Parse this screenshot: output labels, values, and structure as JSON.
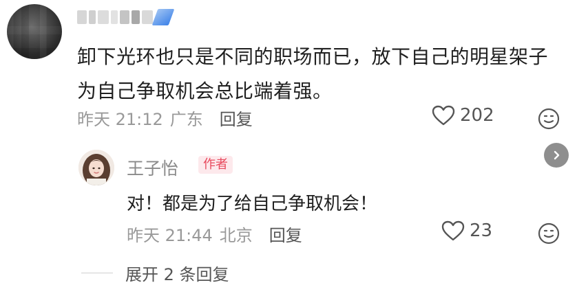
{
  "comment": {
    "text": "卸下光环也只是不同的职场而已，放下自己的明星架子为自己争取机会总比端着强。",
    "time": "昨天 21:12",
    "location": "广东",
    "reply_label": "回复",
    "likes": "202"
  },
  "reply": {
    "username": "王子怡",
    "tag": "作者",
    "text": "对！都是为了给自己争取机会！",
    "time": "昨天 21:44",
    "location": "北京",
    "reply_label": "回复",
    "likes": "23"
  },
  "expand": {
    "label": "展开 2 条回复"
  },
  "icons": {
    "like": "heart-outline-icon",
    "emoji": "smile-face-icon",
    "arrow": "chevron-right-icon"
  },
  "colors": {
    "author_tag_bg": "#fde9ec",
    "author_tag_text": "#e8495d",
    "meta_gray": "#999999"
  }
}
